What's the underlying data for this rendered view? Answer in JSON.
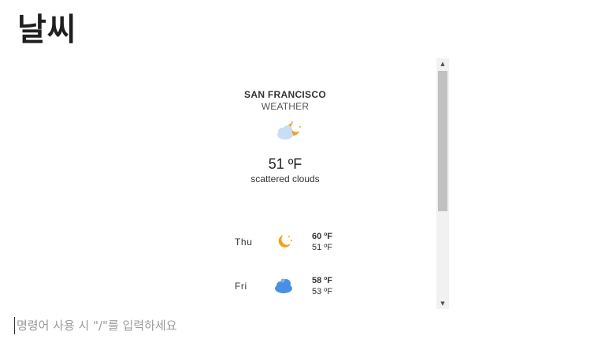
{
  "page": {
    "title": "날씨"
  },
  "weather": {
    "city": "SAN FRANCISCO",
    "subtitle": "WEATHER",
    "current_icon": "partly-cloudy-night-icon",
    "temperature": "51 ºF",
    "description": "scattered clouds",
    "forecast": [
      {
        "day": "Thu",
        "icon": "moon-icon",
        "high": "60 ºF",
        "low": "51 ºF"
      },
      {
        "day": "Fri",
        "icon": "cloud-icon",
        "high": "58 ºF",
        "low": "53 ºF"
      }
    ]
  },
  "command": {
    "placeholder": "명령어 사용 시 \"/\"를 입력하세요",
    "value": ""
  },
  "colors": {
    "sun_moon": "#f4a11d",
    "cloud_light": "#c9ddf5",
    "cloud_blue": "#4a90e2",
    "scroll_track": "#f1f1f1",
    "scroll_thumb": "#c1c1c1"
  }
}
